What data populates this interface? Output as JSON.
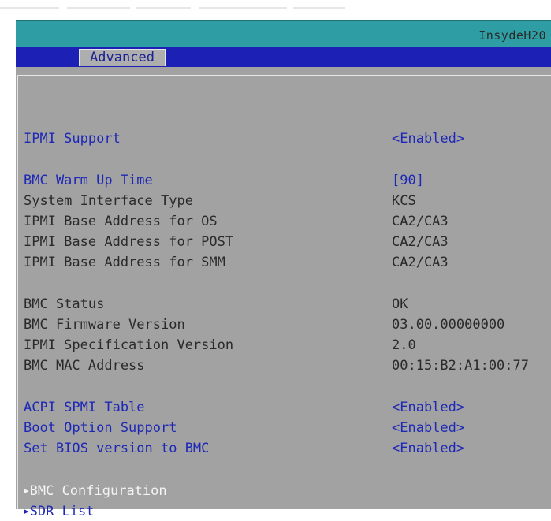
{
  "header": {
    "brand": "InsydeH20",
    "active_tab": "Advanced"
  },
  "settings": {
    "ipmi_support": {
      "label": "IPMI Support",
      "value": "<Enabled>"
    },
    "bmc_warm_up_time": {
      "label": "BMC Warm Up Time",
      "value": "[90]"
    },
    "system_interface_type": {
      "label": "System Interface Type",
      "value": "KCS"
    },
    "ipmi_base_os": {
      "label": "IPMI Base Address for OS",
      "value": "CA2/CA3"
    },
    "ipmi_base_post": {
      "label": "IPMI Base Address for POST",
      "value": "CA2/CA3"
    },
    "ipmi_base_smm": {
      "label": "IPMI Base Address for SMM",
      "value": "CA2/CA3"
    },
    "bmc_status": {
      "label": "BMC Status",
      "value": "OK"
    },
    "bmc_firmware_version": {
      "label": "BMC Firmware Version",
      "value": "03.00.00000000"
    },
    "ipmi_spec_version": {
      "label": "IPMI Specification Version",
      "value": "2.0"
    },
    "bmc_mac_address": {
      "label": "BMC MAC Address",
      "value": "00:15:B2:A1:00:77"
    },
    "acpi_spmi_table": {
      "label": "ACPI SPMI Table",
      "value": "<Enabled>"
    },
    "boot_option_support": {
      "label": "Boot Option Support",
      "value": "<Enabled>"
    },
    "set_bios_version_to_bmc": {
      "label": "Set BIOS version to BMC",
      "value": "<Enabled>"
    }
  },
  "submenus": {
    "bmc_configuration": {
      "label": "BMC Configuration"
    },
    "sdr_list": {
      "label": "SDR List"
    }
  },
  "icons": {
    "submenu_arrow": "▶"
  },
  "colors": {
    "title_bar": "#2f9ea4",
    "tab_bar": "#1c20b4",
    "panel": "#a2a2a2",
    "selectable_text": "#1e28b6",
    "info_text": "#2a2a2a",
    "highlight_text": "#f4f4f4"
  }
}
